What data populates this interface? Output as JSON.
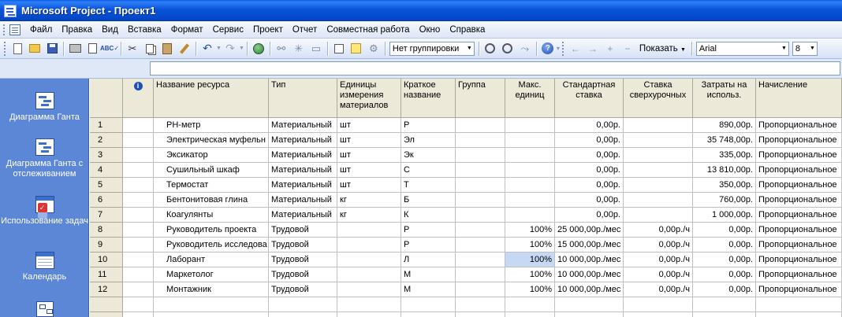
{
  "window": {
    "title": "Microsoft Project - Проект1"
  },
  "menu": [
    "Файл",
    "Правка",
    "Вид",
    "Вставка",
    "Формат",
    "Сервис",
    "Проект",
    "Отчет",
    "Совместная работа",
    "Окно",
    "Справка"
  ],
  "toolbar": {
    "grouping": "Нет группировки",
    "show_label": "Показать",
    "font": "Arial",
    "font_size": "8"
  },
  "viewbar": {
    "items": [
      {
        "label": "Диаграмма Ганта",
        "icon": "gantt-chart-icon"
      },
      {
        "label": "Диаграмма Ганта с отслеживанием",
        "icon": "tracking-gantt-icon"
      },
      {
        "label": "Использование задач",
        "icon": "task-usage-icon"
      },
      {
        "label": "Календарь",
        "icon": "calendar-icon"
      },
      {
        "label": "",
        "icon": "network-diagram-icon"
      }
    ]
  },
  "table": {
    "info_icon": "info-icon",
    "headers": [
      "Название ресурса",
      "Тип",
      "Единицы измерения материалов",
      "Краткое название",
      "Группа",
      "Макс. единиц",
      "Стандартная ставка",
      "Ставка сверхурочных",
      "Затраты на использ.",
      "Начисление"
    ],
    "rows": [
      {
        "n": "1",
        "name": "РН-метр",
        "type": "Материальный",
        "unit": "шт",
        "short": "Р",
        "group": "",
        "max": "",
        "rate": "0,00р.",
        "ot": "",
        "cost": "890,00р.",
        "accrue": "Пропорциональное"
      },
      {
        "n": "2",
        "name": "Электрическая муфельн",
        "type": "Материальный",
        "unit": "шт",
        "short": "Эл",
        "group": "",
        "max": "",
        "rate": "0,00р.",
        "ot": "",
        "cost": "35 748,00р.",
        "accrue": "Пропорциональное"
      },
      {
        "n": "3",
        "name": "Эксикатор",
        "type": "Материальный",
        "unit": "шт",
        "short": "Эк",
        "group": "",
        "max": "",
        "rate": "0,00р.",
        "ot": "",
        "cost": "335,00р.",
        "accrue": "Пропорциональное"
      },
      {
        "n": "4",
        "name": "Сушильный шкаф",
        "type": "Материальный",
        "unit": "шт",
        "short": "С",
        "group": "",
        "max": "",
        "rate": "0,00р.",
        "ot": "",
        "cost": "13 810,00р.",
        "accrue": "Пропорциональное"
      },
      {
        "n": "5",
        "name": "Термостат",
        "type": "Материальный",
        "unit": "шт",
        "short": "Т",
        "group": "",
        "max": "",
        "rate": "0,00р.",
        "ot": "",
        "cost": "350,00р.",
        "accrue": "Пропорциональное"
      },
      {
        "n": "6",
        "name": "Бентонитовая глина",
        "type": "Материальный",
        "unit": "кг",
        "short": "Б",
        "group": "",
        "max": "",
        "rate": "0,00р.",
        "ot": "",
        "cost": "760,00р.",
        "accrue": "Пропорциональное"
      },
      {
        "n": "7",
        "name": "Коагулянты",
        "type": "Материальный",
        "unit": "кг",
        "short": "К",
        "group": "",
        "max": "",
        "rate": "0,00р.",
        "ot": "",
        "cost": "1 000,00р.",
        "accrue": "Пропорциональное"
      },
      {
        "n": "8",
        "name": "Руководитель проекта",
        "type": "Трудовой",
        "unit": "",
        "short": "Р",
        "group": "",
        "max": "100%",
        "rate": "25 000,00р./мес",
        "ot": "0,00р./ч",
        "cost": "0,00р.",
        "accrue": "Пропорциональное"
      },
      {
        "n": "9",
        "name": "Руководитель исследова",
        "type": "Трудовой",
        "unit": "",
        "short": "Р",
        "group": "",
        "max": "100%",
        "rate": "15 000,00р./мес",
        "ot": "0,00р./ч",
        "cost": "0,00р.",
        "accrue": "Пропорциональное"
      },
      {
        "n": "10",
        "name": "Лаборант",
        "type": "Трудовой",
        "unit": "",
        "short": "Л",
        "group": "",
        "max": "100%",
        "rate": "10 000,00р./мес",
        "ot": "0,00р./ч",
        "cost": "0,00р.",
        "accrue": "Пропорциональное"
      },
      {
        "n": "11",
        "name": "Маркетолог",
        "type": "Трудовой",
        "unit": "",
        "short": "М",
        "group": "",
        "max": "100%",
        "rate": "10 000,00р./мес",
        "ot": "0,00р./ч",
        "cost": "0,00р.",
        "accrue": "Пропорциональное"
      },
      {
        "n": "12",
        "name": "Монтажник",
        "type": "Трудовой",
        "unit": "",
        "short": "М",
        "group": "",
        "max": "100%",
        "rate": "10 000,00р./мес",
        "ot": "0,00р./ч",
        "cost": "0,00р.",
        "accrue": "Пропорциональное"
      }
    ]
  }
}
